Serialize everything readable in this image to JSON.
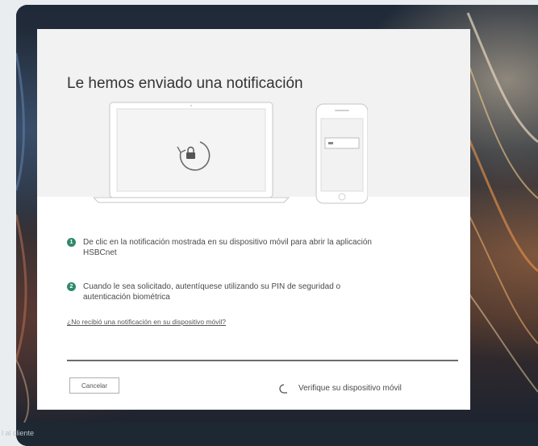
{
  "dialog": {
    "title": "Le hemos enviado una notificación",
    "steps": [
      {
        "number": "1",
        "text": "De clic en la notificación mostrada en su dispositivo móvil para abrir la aplicación HSBCnet"
      },
      {
        "number": "2",
        "text": "Cuando le sea solicitado, autentíquese utilizando su PIN de seguridad o autenticación biométrica"
      }
    ],
    "help_link": "¿No recibió una notificación en su dispositivo móvil?",
    "cancel_label": "Cancelar",
    "status_text": "Verifique su dispositivo móvil"
  },
  "footer": {
    "link_text": "l al cliente"
  },
  "colors": {
    "accent": "#2f8a6a",
    "dialog_background": "#ffffff",
    "hero_background": "#f2f2f2",
    "page_background": "#1d2833"
  },
  "icons": {
    "laptop": "laptop-icon",
    "lock": "lock-icon",
    "phone": "mobile-phone-icon",
    "spinner": "loading-spinner-icon"
  }
}
